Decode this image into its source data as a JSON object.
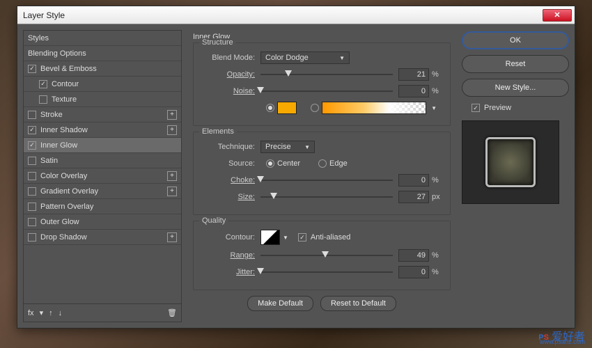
{
  "title": "Layer Style",
  "sidebar": {
    "items": [
      {
        "label": "Styles",
        "cb": null
      },
      {
        "label": "Blending Options",
        "cb": null
      },
      {
        "label": "Bevel & Emboss",
        "cb": "on",
        "plus": false
      },
      {
        "label": "Contour",
        "cb": "on",
        "indent": true
      },
      {
        "label": "Texture",
        "cb": "off",
        "indent": true
      },
      {
        "label": "Stroke",
        "cb": "off",
        "plus": true
      },
      {
        "label": "Inner Shadow",
        "cb": "on",
        "plus": true
      },
      {
        "label": "Inner Glow",
        "cb": "on",
        "sel": true
      },
      {
        "label": "Satin",
        "cb": "off"
      },
      {
        "label": "Color Overlay",
        "cb": "off",
        "plus": true
      },
      {
        "label": "Gradient Overlay",
        "cb": "off",
        "plus": true
      },
      {
        "label": "Pattern Overlay",
        "cb": "off"
      },
      {
        "label": "Outer Glow",
        "cb": "off"
      },
      {
        "label": "Drop Shadow",
        "cb": "off",
        "plus": true
      }
    ],
    "footer": {
      "fx": "fx"
    }
  },
  "panel": {
    "title": "Inner Glow",
    "structure": {
      "legend": "Structure",
      "blend_label": "Blend Mode:",
      "blend_value": "Color Dodge",
      "opacity_label": "Opacity:",
      "opacity_value": "21",
      "opacity_unit": "%",
      "opacity_pct": 21,
      "noise_label": "Noise:",
      "noise_value": "0",
      "noise_unit": "%",
      "noise_pct": 0,
      "solid_color": "#f7a900"
    },
    "elements": {
      "legend": "Elements",
      "tech_label": "Technique:",
      "tech_value": "Precise",
      "source_label": "Source:",
      "center": "Center",
      "edge": "Edge",
      "choke_label": "Choke:",
      "choke_value": "0",
      "choke_unit": "%",
      "choke_pct": 0,
      "size_label": "Size:",
      "size_value": "27",
      "size_unit": "px",
      "size_pct": 10
    },
    "quality": {
      "legend": "Quality",
      "contour_label": "Contour:",
      "aa_label": "Anti-aliased",
      "range_label": "Range:",
      "range_value": "49",
      "range_unit": "%",
      "range_pct": 49,
      "jitter_label": "Jitter:",
      "jitter_value": "0",
      "jitter_unit": "%",
      "jitter_pct": 0
    },
    "make_default": "Make Default",
    "reset_default": "Reset to Default"
  },
  "right": {
    "ok": "OK",
    "reset": "Reset",
    "newstyle": "New Style...",
    "preview": "Preview"
  },
  "watermark": {
    "cn": "爱好者",
    "url": "www.psahz.com"
  }
}
